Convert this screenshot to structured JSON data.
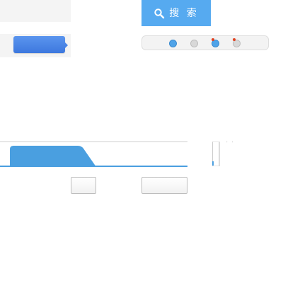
{
  "search": {
    "label": "搜 索",
    "icon": "search-icon",
    "background": "#56aaf0"
  },
  "primary_button": {
    "color": "#4a85e6"
  },
  "pager": {
    "dots": [
      {
        "state": "active",
        "color": "#4fa3e8",
        "badge": false
      },
      {
        "state": "inactive",
        "color": "#d8d8d8",
        "badge": false
      },
      {
        "state": "active",
        "color": "#4fa3e8",
        "badge": true
      },
      {
        "state": "inactive",
        "color": "#d8d8d8",
        "badge": true
      }
    ],
    "badge_color": "#e0401f"
  },
  "tabs": {
    "active_color": "#4a9fe0",
    "items": [
      {
        "label": "",
        "active": true
      }
    ]
  },
  "side_marks": "' '",
  "buttons": [
    {
      "label": ""
    },
    {
      "label": ""
    }
  ]
}
